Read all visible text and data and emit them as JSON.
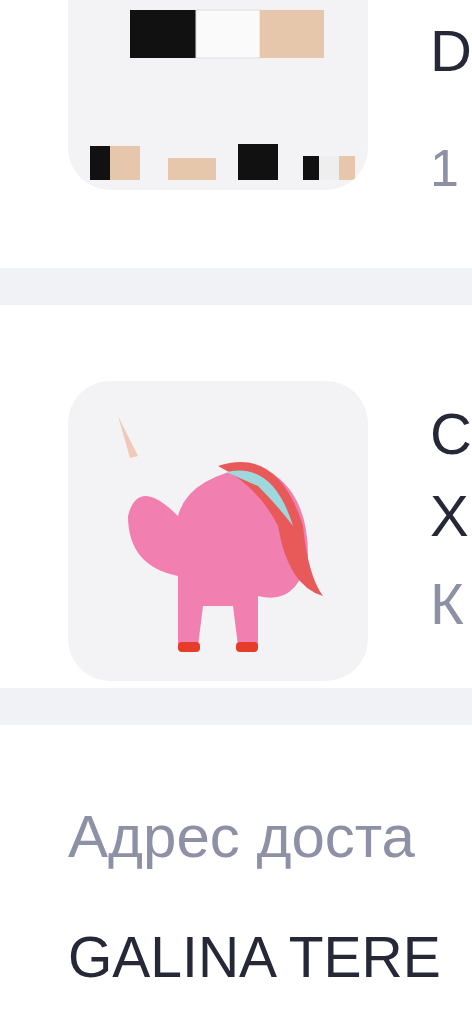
{
  "products": [
    {
      "kind": "hooks",
      "title_lines": [
        "D"
      ],
      "subtitle": "1"
    },
    {
      "kind": "balloon",
      "title_lines": [
        "С",
        "Х"
      ],
      "subtitle": "К"
    }
  ],
  "delivery": {
    "label": "Адрес доста",
    "name": "GALINA TERE"
  }
}
